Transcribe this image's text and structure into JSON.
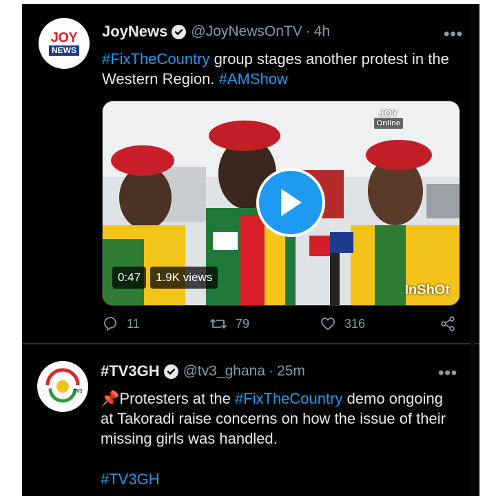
{
  "tweets": [
    {
      "author": "JoyNews",
      "handle": "@JoyNewsOnTV",
      "time": "4h",
      "more": "•••",
      "avatar_lines": [
        "JOY",
        "NEWS"
      ],
      "text_tag1": "#FixTheCountry",
      "text_main": " group stages another protest in the Western Region. ",
      "text_tag2": "#AMShow",
      "video": {
        "duration": "0:47",
        "views": "1.9K views",
        "watermark_top": "JOY",
        "watermark_sub": "Online",
        "watermark_bottom": "InShOt"
      },
      "replies": "11",
      "retweets": "79",
      "likes": "316"
    },
    {
      "author": "#TV3GH",
      "handle": "@tv3_ghana",
      "time": "25m",
      "more": "•••",
      "pin_emoji": "📌",
      "text_pre": "Protesters at the ",
      "text_tag": "#FixTheCountry",
      "text_main": " demo ongoing at Takoradi raise concerns on how the issue of their missing girls was handled.",
      "hashtag_line": "#TV3GH"
    }
  ],
  "icons": {
    "verified": "verified-badge-icon",
    "reply": "reply-icon",
    "retweet": "retweet-icon",
    "like": "heart-icon",
    "share": "share-icon",
    "play": "play-icon"
  },
  "colors": {
    "background": "#000000",
    "text": "#e7e9ea",
    "secondary": "#8b98a5",
    "accent": "#1d9bf0"
  }
}
